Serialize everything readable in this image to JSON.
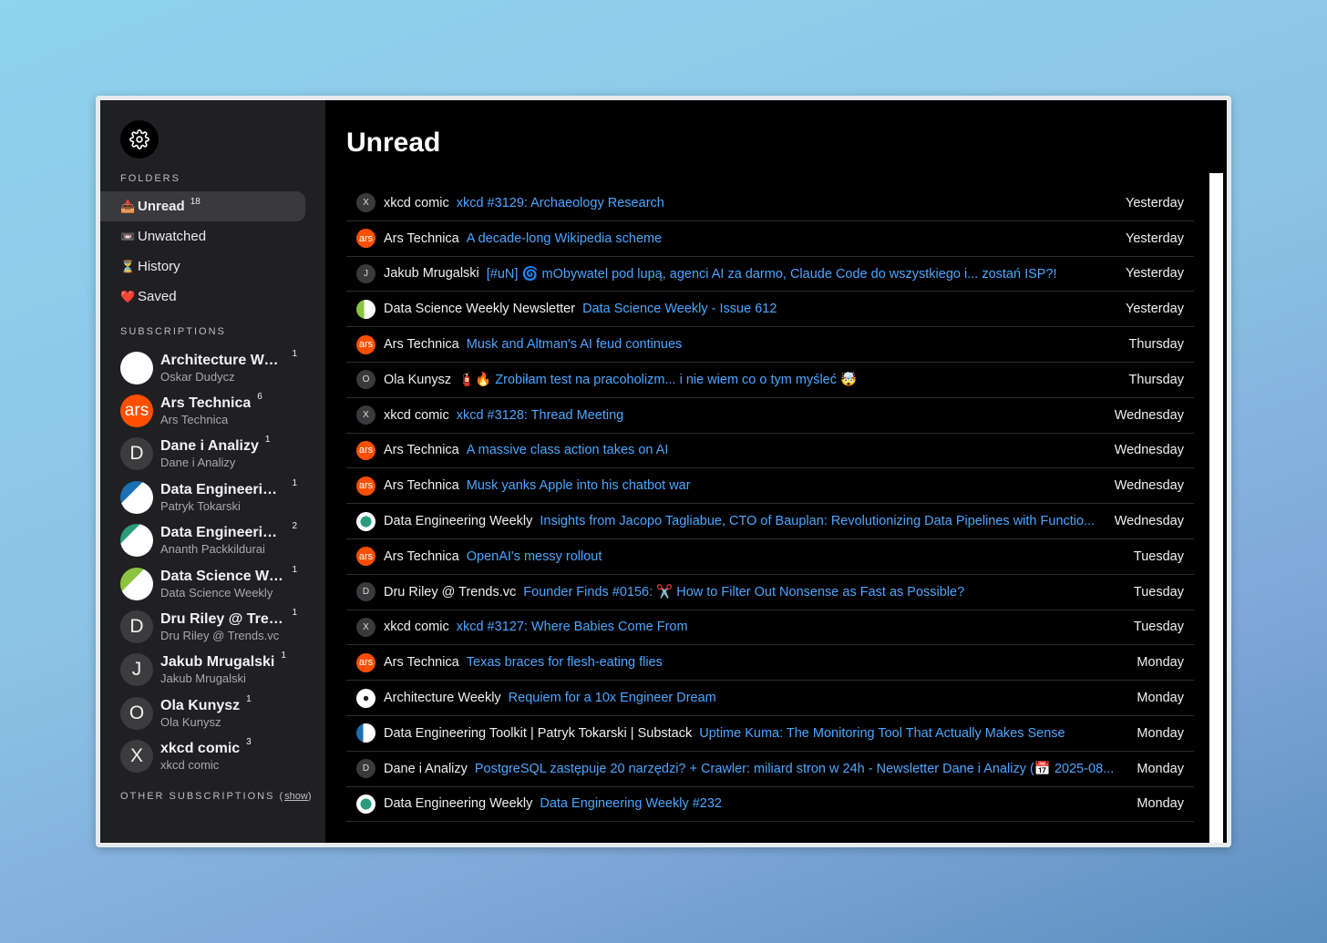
{
  "folders_label": "FOLDERS",
  "folders": [
    {
      "icon": "📥",
      "label": "Unread",
      "count": "18"
    },
    {
      "icon": "📼",
      "label": "Unwatched",
      "count": ""
    },
    {
      "icon": "⏳",
      "label": "History",
      "count": ""
    },
    {
      "icon": "❤️",
      "label": "Saved",
      "count": ""
    }
  ],
  "subscriptions_label": "SUBSCRIPTIONS",
  "subscriptions": [
    {
      "title": "Architecture Wee...",
      "count": "1",
      "author": "Oskar Dudycz",
      "avatar": ""
    },
    {
      "title": "Ars Technica",
      "count": "6",
      "author": "Ars Technica",
      "avatar": "ars"
    },
    {
      "title": "Dane i Analizy",
      "count": "1",
      "author": "Dane i Analizy",
      "avatar": "D"
    },
    {
      "title": "Data Engineering ...",
      "count": "1",
      "author": "Patryk Tokarski",
      "avatar": ""
    },
    {
      "title": "Data Engineering...",
      "count": "2",
      "author": "Ananth Packkildurai",
      "avatar": ""
    },
    {
      "title": "Data Science We...",
      "count": "1",
      "author": "Data Science Weekly",
      "avatar": ""
    },
    {
      "title": "Dru Riley @ Tren...",
      "count": "1",
      "author": "Dru Riley @ Trends.vc",
      "avatar": "D"
    },
    {
      "title": "Jakub Mrugalski",
      "count": "1",
      "author": "Jakub Mrugalski",
      "avatar": "J"
    },
    {
      "title": "Ola Kunysz",
      "count": "1",
      "author": "Ola Kunysz",
      "avatar": "O"
    },
    {
      "title": "xkcd comic",
      "count": "3",
      "author": "xkcd comic",
      "avatar": "X"
    }
  ],
  "other_label": "OTHER SUBSCRIPTIONS",
  "other_show": "show",
  "main_title": "Unread",
  "items": [
    {
      "icon": "X",
      "source": "xkcd comic",
      "title": "xkcd #3129: Archaeology Research",
      "date": "Yesterday"
    },
    {
      "icon": "ars",
      "source": "Ars Technica",
      "title": "A decade-long Wikipedia scheme",
      "date": "Yesterday"
    },
    {
      "icon": "J",
      "source": "Jakub Mrugalski",
      "title": "[#uN] 🌀 mObywatel pod lupą, agenci AI za darmo, Claude Code do wszystkiego i... zostań ISP?!",
      "date": "Yesterday"
    },
    {
      "icon": "",
      "source": "Data Science Weekly Newsletter",
      "title": "Data Science Weekly - Issue 612",
      "date": "Yesterday"
    },
    {
      "icon": "ars",
      "source": "Ars Technica",
      "title": "Musk and Altman's AI feud continues",
      "date": "Thursday"
    },
    {
      "icon": "O",
      "source": "Ola Kunysz",
      "title": "🧯🔥 Zrobiłam test na pracoholizm... i nie wiem co o tym myśleć 🤯",
      "date": "Thursday"
    },
    {
      "icon": "X",
      "source": "xkcd comic",
      "title": "xkcd #3128: Thread Meeting",
      "date": "Wednesday"
    },
    {
      "icon": "ars",
      "source": "Ars Technica",
      "title": "A massive class action takes on AI",
      "date": "Wednesday"
    },
    {
      "icon": "ars",
      "source": "Ars Technica",
      "title": "Musk yanks Apple into his chatbot war",
      "date": "Wednesday"
    },
    {
      "icon": "",
      "source": "Data Engineering Weekly",
      "title": "Insights from Jacopo Tagliabue, CTO of Bauplan: Revolutionizing Data Pipelines with Functio...",
      "date": "Wednesday"
    },
    {
      "icon": "ars",
      "source": "Ars Technica",
      "title": "OpenAI's messy rollout",
      "date": "Tuesday"
    },
    {
      "icon": "D",
      "source": "Dru Riley @ Trends.vc",
      "title": "Founder Finds #0156: ✂️ How to Filter Out Nonsense as Fast as Possible?",
      "date": "Tuesday"
    },
    {
      "icon": "X",
      "source": "xkcd comic",
      "title": "xkcd #3127: Where Babies Come From",
      "date": "Tuesday"
    },
    {
      "icon": "ars",
      "source": "Ars Technica",
      "title": "Texas braces for flesh-eating flies",
      "date": "Monday"
    },
    {
      "icon": "",
      "source": "Architecture Weekly",
      "title": "Requiem for a 10x Engineer Dream",
      "date": "Monday"
    },
    {
      "icon": "",
      "source": "Data Engineering Toolkit | Patryk Tokarski | Substack",
      "title": "Uptime Kuma: The Monitoring Tool That Actually Makes Sense",
      "date": "Monday"
    },
    {
      "icon": "D",
      "source": "Dane i Analizy",
      "title": "PostgreSQL zastępuje 20 narzędzi? + Crawler: miliard stron w 24h - Newsletter Dane i Analizy (📅 2025-08...",
      "date": "Monday"
    },
    {
      "icon": "",
      "source": "Data Engineering Weekly",
      "title": "Data Engineering Weekly #232",
      "date": "Monday"
    }
  ]
}
